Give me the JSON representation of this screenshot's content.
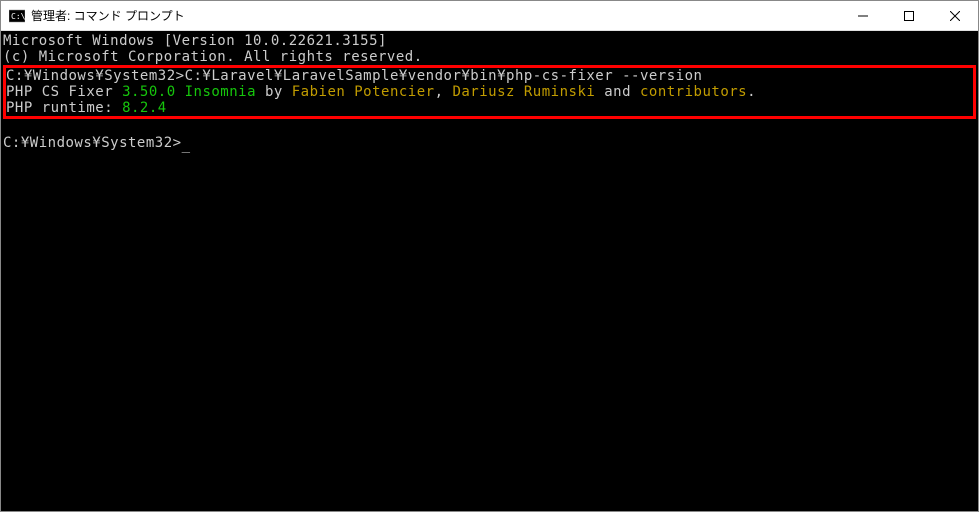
{
  "window": {
    "title": "管理者: コマンド プロンプト"
  },
  "terminal": {
    "line1": "Microsoft Windows [Version 10.0.22621.3155]",
    "line2": "(c) Microsoft Corporation. All rights reserved.",
    "blank1": "",
    "highlighted": {
      "prompt1": "C:¥Windows¥System32>",
      "command1": "C:¥Laravel¥LaravelSample¥vendor¥bin¥php-cs-fixer --version",
      "fixer_prefix": "PHP CS Fixer ",
      "fixer_version": "3.50.0",
      "fixer_codename": " Insomnia",
      "by": " by ",
      "author1": "Fabien Potencier",
      "comma": ", ",
      "author2": "Dariusz Ruminski",
      "and": " and ",
      "contributors": "contributors",
      "period": ".",
      "runtime_label": "PHP runtime: ",
      "runtime_version": "8.2.4"
    },
    "prompt2": "C:¥Windows¥System32>"
  }
}
